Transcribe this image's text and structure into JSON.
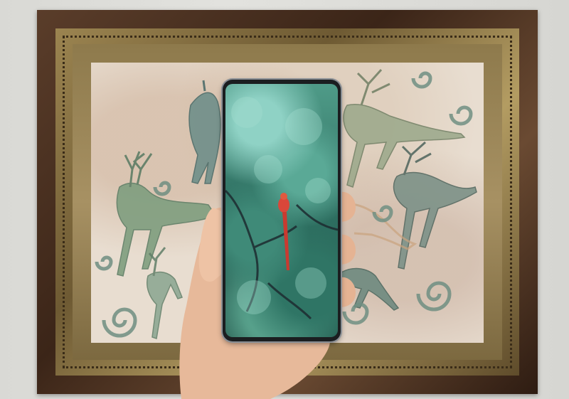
{
  "scene": {
    "description_label": "",
    "colors": {
      "wall": "#dcdcd8",
      "frame_wood": "#4a2f1f",
      "frame_gold": "#9b8450",
      "canvas": "#e8ddd0",
      "deer": "#7f9a86",
      "phone_body": "#1b1e20",
      "foliage": "#3f8a78",
      "parrot": "#d9473a",
      "skin": "#e7b99a"
    },
    "icons": [
      "deer-figure",
      "spiral-motif",
      "parrot",
      "hand"
    ]
  }
}
